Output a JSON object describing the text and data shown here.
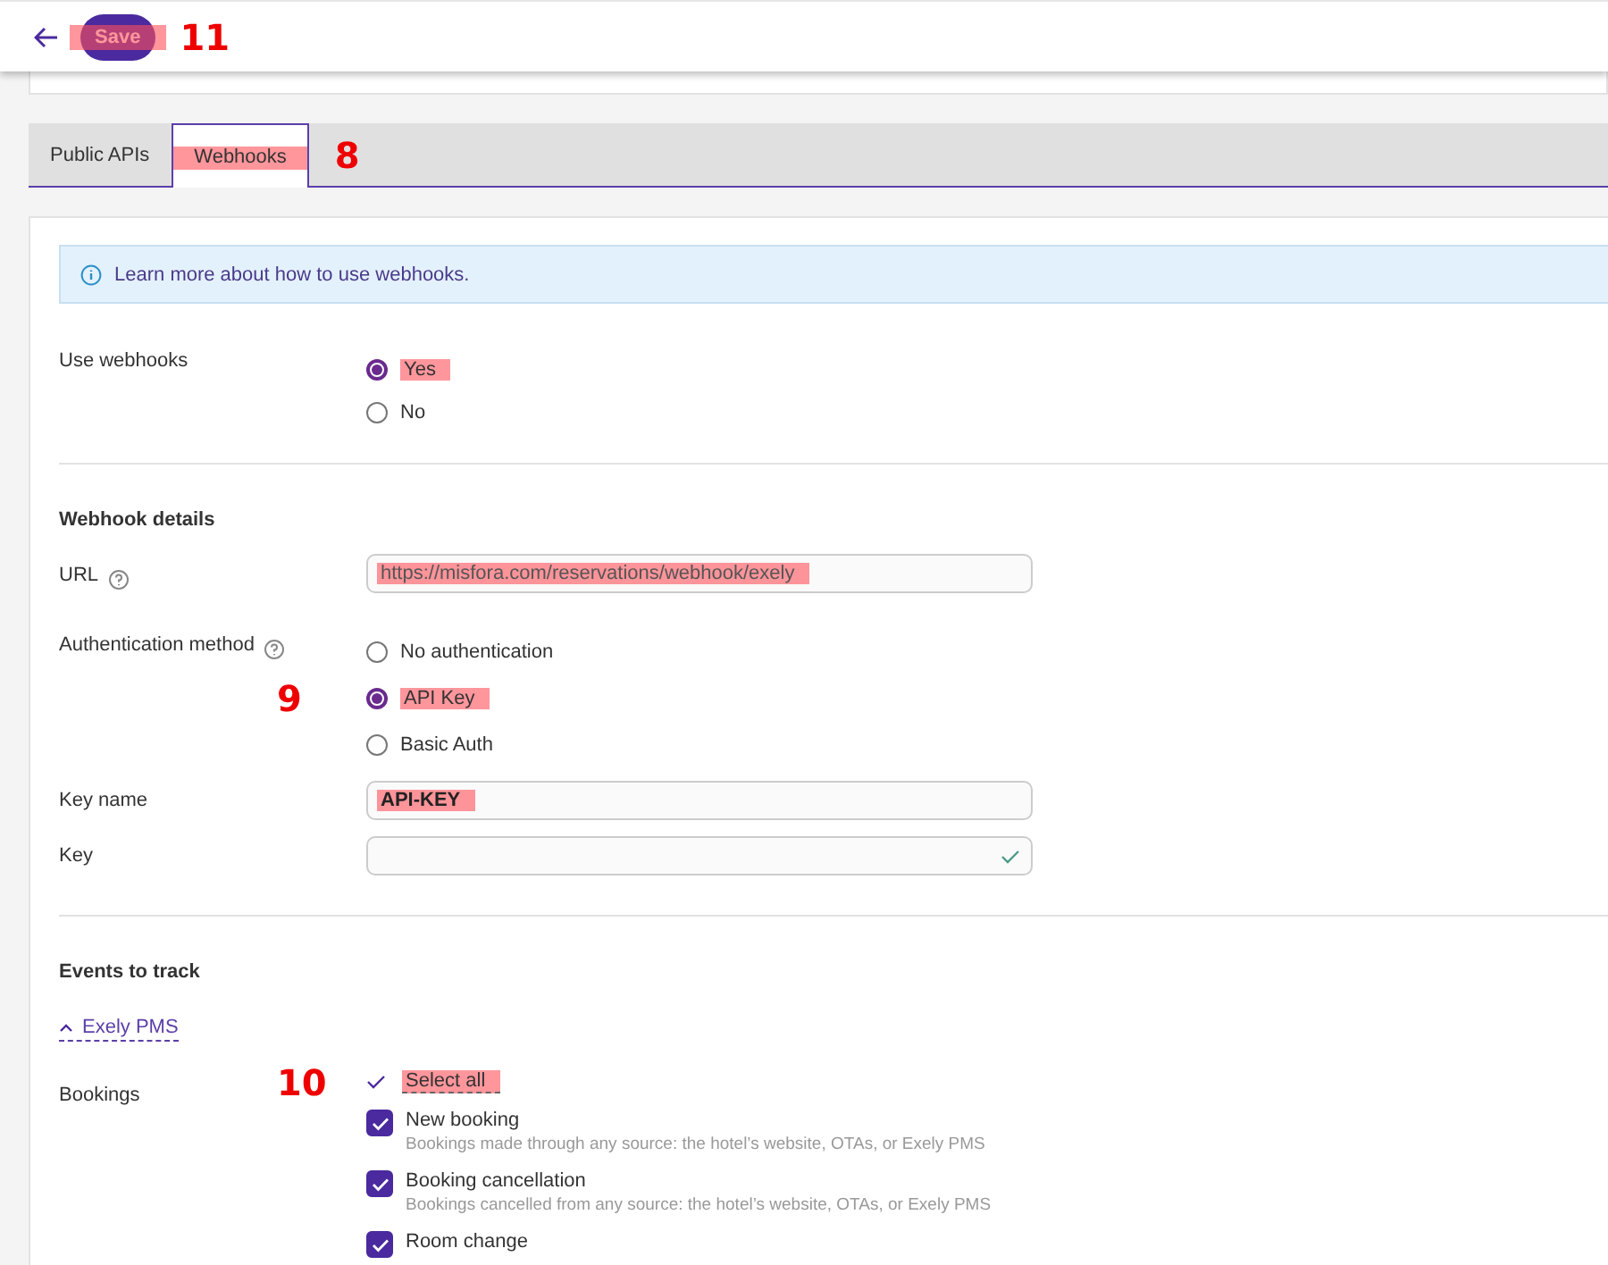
{
  "header": {
    "save": {
      "label": "Save",
      "highlighted": true,
      "callout": "11"
    }
  },
  "tabs": [
    {
      "label": "Public APIs",
      "selected": false,
      "highlighted": false
    },
    {
      "label": "Webhooks",
      "selected": true,
      "highlighted": true,
      "callout": "8"
    }
  ],
  "info": {
    "text": "Learn more about how to use webhooks."
  },
  "use_webhooks": {
    "label": "Use webhooks",
    "options": [
      {
        "label": "Yes",
        "selected": true,
        "highlighted": true
      },
      {
        "label": "No",
        "selected": false,
        "highlighted": false
      }
    ]
  },
  "details": {
    "title": "Webhook details",
    "url": {
      "label": "URL",
      "value": "https://misfora.com/reservations/webhook/exely",
      "highlighted": true
    },
    "auth": {
      "label": "Authentication method",
      "options": [
        {
          "label": "No authentication",
          "selected": false,
          "highlighted": false
        },
        {
          "label": "API Key",
          "selected": true,
          "highlighted": true,
          "callout": "9"
        },
        {
          "label": "Basic Auth",
          "selected": false,
          "highlighted": false
        }
      ]
    },
    "key_name": {
      "label": "Key name",
      "value": "API-KEY",
      "highlighted": true
    },
    "key": {
      "label": "Key"
    }
  },
  "events": {
    "title": "Events to track",
    "group": {
      "label": "Exely PMS",
      "expanded": true
    },
    "bookings": {
      "label": "Bookings",
      "select_all": {
        "label": "Select all",
        "highlighted": true,
        "callout": "10"
      },
      "items": [
        {
          "label": "New booking",
          "description": "Bookings made through any source: the hotel’s website, OTAs, or Exely PMS",
          "checked": true
        },
        {
          "label": "Booking cancellation",
          "description": "Bookings cancelled from any source: the hotel’s website, OTAs, or Exely PMS",
          "checked": true
        },
        {
          "label": "Room change",
          "checked": true
        }
      ]
    }
  }
}
